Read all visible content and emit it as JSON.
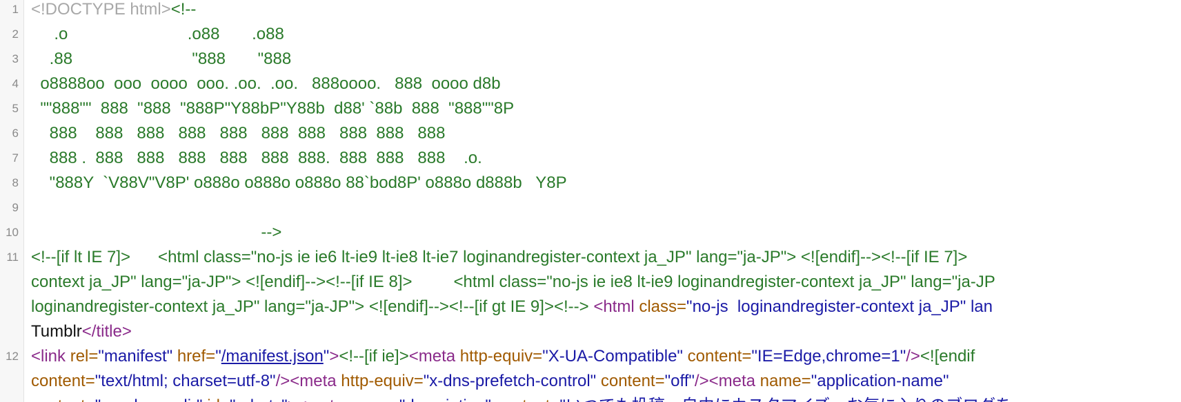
{
  "source": {
    "lines": [
      {
        "number": "1",
        "parts": [
          {
            "type": "doctype",
            "text": "<!DOCTYPE html>"
          },
          {
            "type": "comment",
            "text": "<!--"
          }
        ]
      },
      {
        "number": "2",
        "parts": [
          {
            "type": "comment",
            "text": "     .o                          .o88       .o88"
          }
        ]
      },
      {
        "number": "3",
        "parts": [
          {
            "type": "comment",
            "text": "    .88                          \"888       \"888"
          }
        ]
      },
      {
        "number": "4",
        "parts": [
          {
            "type": "comment",
            "text": "  o8888oo  ooo  oooo  ooo. .oo.  .oo.   888oooo.   888  oooo d8b"
          }
        ]
      },
      {
        "number": "5",
        "parts": [
          {
            "type": "comment",
            "text": "  \"\"888\"\"  888  \"888  \"888P\"Y88bP\"Y88b  d88' `88b  888  \"888\"\"8P"
          }
        ]
      },
      {
        "number": "6",
        "parts": [
          {
            "type": "comment",
            "text": "    888    888   888   888   888   888  888   888  888   888"
          }
        ]
      },
      {
        "number": "7",
        "parts": [
          {
            "type": "comment",
            "text": "    888 .  888   888   888   888   888  888.  888  888   888    .o."
          }
        ]
      },
      {
        "number": "8",
        "parts": [
          {
            "type": "comment",
            "text": "    \"888Y  `V88V\"V8P' o888o o888o o888o 88`bod8P' o888o d888b   Y8P"
          }
        ]
      },
      {
        "number": "9",
        "parts": []
      },
      {
        "number": "10",
        "parts": [
          {
            "type": "comment",
            "text": "                                                  -->"
          }
        ]
      },
      {
        "number": "11",
        "parts": [
          {
            "type": "ie",
            "text": "<!--[if lt IE 7]>      <html class=\"no-js ie ie6 lt-ie9 lt-ie8 lt-ie7 loginandregister-context ja_JP\" lang=\"ja-JP\"> <![endif]--><!--[if IE 7]>"
          }
        ]
      },
      {
        "number": "",
        "parts": [
          {
            "type": "ie",
            "text": "context ja_JP\" lang=\"ja-JP\"> <![endif]--><!--[if IE 8]>         <html class=\"no-js ie ie8 lt-ie9 loginandregister-context ja_JP\" lang=\"ja-JP"
          }
        ]
      },
      {
        "number": "",
        "parts": [
          {
            "type": "ie",
            "text": "loginandregister-context ja_JP\" lang=\"ja-JP\"> <![endif]--><!--[if gt IE 9]><!--> "
          },
          {
            "type": "tag",
            "text": "<html "
          },
          {
            "type": "attr",
            "text": "class="
          },
          {
            "type": "val",
            "text": "\"no-js  loginandregister-context ja_JP\" lan"
          }
        ]
      },
      {
        "number": "",
        "parts": [
          {
            "type": "text",
            "text": "Tumblr"
          },
          {
            "type": "tag",
            "text": "</title>"
          }
        ]
      },
      {
        "number": "12",
        "parts": [
          {
            "type": "tag",
            "text": "<link "
          },
          {
            "type": "attr",
            "text": "rel="
          },
          {
            "type": "val",
            "text": "\"manifest\" "
          },
          {
            "type": "attr",
            "text": "href="
          },
          {
            "type": "val",
            "text": "\""
          },
          {
            "type": "link",
            "text": "/manifest.json"
          },
          {
            "type": "val",
            "text": "\""
          },
          {
            "type": "tag",
            "text": ">"
          },
          {
            "type": "ie",
            "text": "<!--[if ie]>"
          },
          {
            "type": "tag",
            "text": "<meta "
          },
          {
            "type": "attr",
            "text": "http-equiv="
          },
          {
            "type": "val",
            "text": "\"X-UA-Compatible\" "
          },
          {
            "type": "attr",
            "text": "content="
          },
          {
            "type": "val",
            "text": "\"IE=Edge,chrome=1\""
          },
          {
            "type": "tag",
            "text": "/>"
          },
          {
            "type": "ie",
            "text": "<![endif"
          }
        ]
      },
      {
        "number": "",
        "parts": [
          {
            "type": "attr",
            "text": "content="
          },
          {
            "type": "val",
            "text": "\"text/html; charset=utf-8\""
          },
          {
            "type": "tag",
            "text": "/><meta "
          },
          {
            "type": "attr",
            "text": "http-equiv="
          },
          {
            "type": "val",
            "text": "\"x-dns-prefetch-control\" "
          },
          {
            "type": "attr",
            "text": "content="
          },
          {
            "type": "val",
            "text": "\"off\""
          },
          {
            "type": "tag",
            "text": "/><meta "
          },
          {
            "type": "attr",
            "text": "name="
          },
          {
            "type": "val",
            "text": "\"application-name\" "
          }
        ]
      },
      {
        "number": "",
        "parts": [
          {
            "type": "attr",
            "text": "content="
          },
          {
            "type": "val",
            "text": "\"noodp,noydir\" "
          },
          {
            "type": "attr",
            "text": "id="
          },
          {
            "type": "val",
            "text": "\"robots\""
          },
          {
            "type": "tag",
            "text": "><meta "
          },
          {
            "type": "attr",
            "text": "name="
          },
          {
            "type": "val",
            "text": "\"description\" "
          },
          {
            "type": "attr",
            "text": "content="
          },
          {
            "type": "val",
            "text": "\"いつでも投稿、自由にカスタマイズ、お気に入りのブログを"
          }
        ]
      }
    ]
  }
}
